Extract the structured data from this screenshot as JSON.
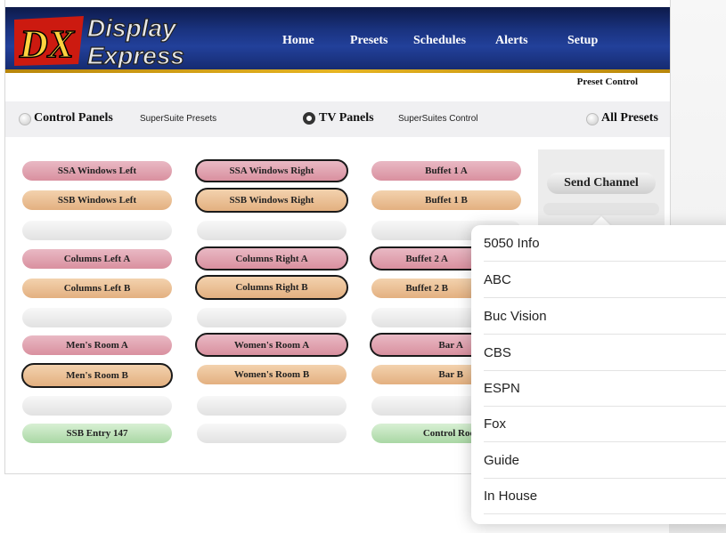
{
  "header": {
    "logo_text": "DX Display Express",
    "nav": [
      "Home",
      "Presets",
      "Schedules",
      "Alerts",
      "Setup"
    ]
  },
  "subheader": {
    "title": "Preset Control"
  },
  "modes": [
    {
      "label": "Control Panels",
      "sub": "SuperSuite Presets",
      "selected": false
    },
    {
      "label": "TV Panels",
      "sub": "SuperSuites Control",
      "selected": true
    },
    {
      "label": "All Presets",
      "selected": false
    }
  ],
  "col1": [
    "SSA Windows Left",
    "SSB Windows Left",
    "",
    "Columns Left A",
    "Columns Left B",
    "",
    "Men's Room A",
    "Men's Room B",
    "",
    "SSB Entry 147"
  ],
  "col2": [
    "SSA Windows Right",
    "SSB Windows Right",
    "",
    "Columns Right A",
    "Columns Right B",
    "",
    "Women's Room A",
    "Women's Room B",
    "",
    ""
  ],
  "col3": [
    "Buffet 1 A",
    "Buffet 1 B",
    "",
    "Buffet 2 A",
    "Buffet 2 B",
    "",
    "Bar A",
    "Bar B",
    "",
    "Control Roo"
  ],
  "send": {
    "label": "Send Channel"
  },
  "channels": [
    "5050 Info",
    "ABC",
    "Buc Vision",
    "CBS",
    "ESPN",
    "Fox",
    "Guide",
    "In House"
  ]
}
